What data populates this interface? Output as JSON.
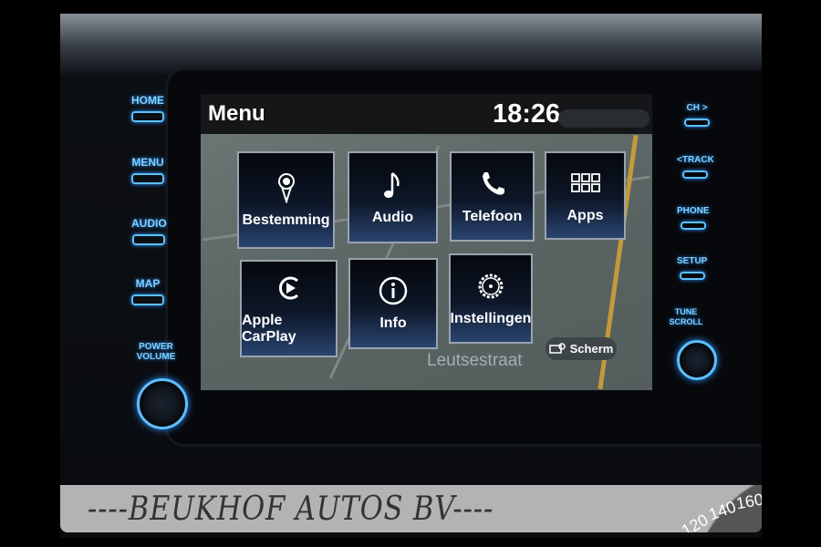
{
  "left_buttons": [
    {
      "label": "HOME"
    },
    {
      "label": "MENU"
    },
    {
      "label": "AUDIO"
    },
    {
      "label": "MAP"
    },
    {
      "label": "POWER VOLUME"
    }
  ],
  "right_buttons": [
    {
      "label": "CH >"
    },
    {
      "label": "<TRACK"
    },
    {
      "label": "PHONE"
    },
    {
      "label": "SETUP"
    },
    {
      "label": "TUNE SCROLL"
    }
  ],
  "screen": {
    "title": "Menu",
    "time": "18:26",
    "tiles": [
      {
        "label": "Bestemming",
        "icon": "map-pin-icon"
      },
      {
        "label": "Audio",
        "icon": "music-note-icon"
      },
      {
        "label": "Telefoon",
        "icon": "phone-icon"
      },
      {
        "label": "Apps",
        "icon": "apps-grid-icon"
      },
      {
        "label": "Apple CarPlay",
        "icon": "carplay-icon"
      },
      {
        "label": "Info",
        "icon": "info-icon"
      },
      {
        "label": "Instellingen",
        "icon": "gear-icon"
      }
    ],
    "street": "Leutsestraat",
    "scherm_label": "Scherm"
  },
  "banner": {
    "text": "----BEUKHOF AUTOS BV----",
    "speedo_ticks": [
      "120",
      "140",
      "160"
    ]
  },
  "colors": {
    "button_glow": "#5cc0ff",
    "tile_border": "#9aa3ad",
    "banner": "#b3b3b3"
  }
}
